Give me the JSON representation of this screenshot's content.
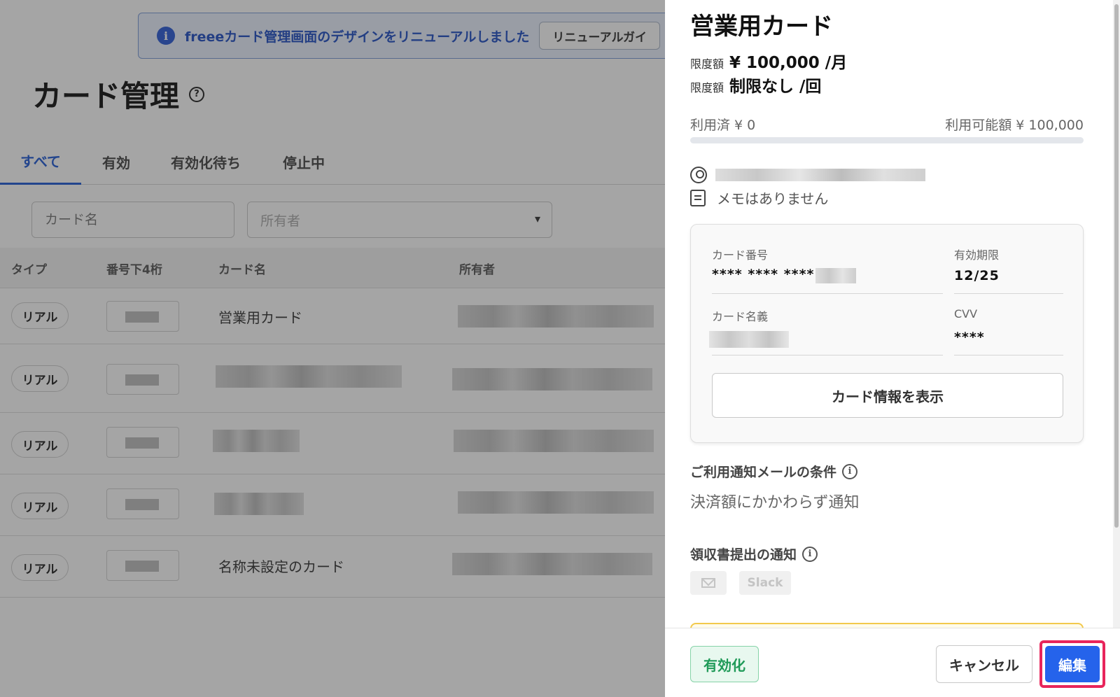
{
  "banner": {
    "message": "freeeカード管理画面のデザインをリニューアルしました",
    "guide_label": "リニューアルガイ"
  },
  "page": {
    "title": "カード管理",
    "help_icon": "?",
    "tabs": [
      {
        "label": "すべて",
        "active": true
      },
      {
        "label": "有効",
        "active": false
      },
      {
        "label": "有効化待ち",
        "active": false
      },
      {
        "label": "停止中",
        "active": false
      }
    ],
    "filters": {
      "card_name_placeholder": "カード名",
      "owner_placeholder": "所有者",
      "chevron": "▾"
    },
    "table": {
      "headers": [
        "タイプ",
        "番号下4桁",
        "カード名",
        "所有者"
      ],
      "rows": [
        {
          "type": "リアル",
          "name": "営業用カード"
        },
        {
          "type": "リアル",
          "name": ""
        },
        {
          "type": "リアル",
          "name": ""
        },
        {
          "type": "リアル",
          "name": ""
        },
        {
          "type": "リアル",
          "name": "名称未設定のカード"
        }
      ]
    }
  },
  "panel": {
    "title": "営業用カード",
    "limit_monthly": {
      "label": "限度額",
      "value": "¥ 100,000 /月"
    },
    "limit_per_use": {
      "label": "限度額",
      "value": "制限なし /回"
    },
    "used": "利用済 ¥ 0",
    "available": "利用可能額 ¥ 100,000",
    "usage_fraction": 0,
    "memo": "メモはありません",
    "card": {
      "number_label": "カード番号",
      "number_value": "**** **** ****",
      "expiry_label": "有効期限",
      "expiry_value": "12/25",
      "holder_label": "カード名義",
      "cvv_label": "CVV",
      "cvv_value": "****",
      "show_button": "カード情報を表示"
    },
    "notify_mail": {
      "title": "ご利用通知メールの条件",
      "value": "決済額にかかわらず通知"
    },
    "receipt_notify": {
      "title": "領収書提出の通知",
      "slack_label": "Slack"
    },
    "info_icon": "i",
    "footer": {
      "activate": "有効化",
      "cancel": "キャンセル",
      "edit": "編集"
    }
  }
}
